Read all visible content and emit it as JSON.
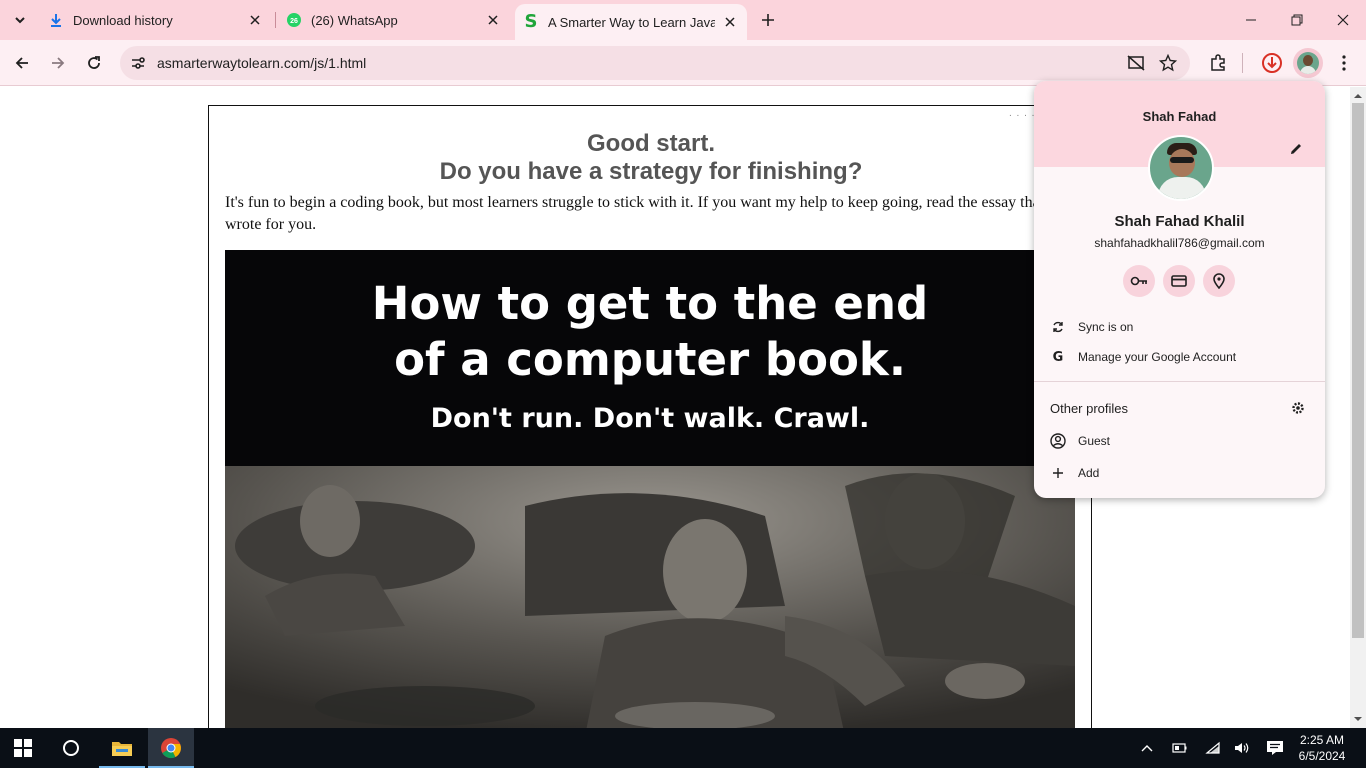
{
  "browser": {
    "tabs": [
      {
        "title": "Download history",
        "icon": "download-icon"
      },
      {
        "title": "(26) WhatsApp",
        "icon": "whatsapp-icon",
        "badge": "26"
      },
      {
        "title": "A Smarter Way to Learn JavaScript",
        "icon": "smarter-way-icon"
      }
    ],
    "url": "asmarterwaytolearn.com/js/1.html"
  },
  "page": {
    "heading1": "Good start.",
    "heading2": "Do you have a strategy for finishing?",
    "intro": "It's fun to begin a coding book, but most learners struggle to stick with it. If you want my help to keep going, read the essay that I wrote for you.",
    "banner": {
      "line1": "How to get to the end",
      "line2": "of a computer book.",
      "line3": "Don't run. Don't walk. Crawl."
    }
  },
  "profile_menu": {
    "header_name": "Shah Fahad",
    "full_name": "Shah Fahad Khalil",
    "email": "shahfahadkhalil786@gmail.com",
    "sync": "Sync is on",
    "manage": "Manage your Google Account",
    "other_profiles": "Other profiles",
    "guest": "Guest",
    "add": "Add"
  },
  "taskbar": {
    "time": "2:25 AM",
    "date": "6/5/2024"
  },
  "colors": {
    "tabstrip": "#fbd4dc",
    "toolbar": "#fdeff3",
    "menu_header": "#fcd7df",
    "download_red": "#d93025",
    "whatsapp_green": "#25d366",
    "smarter_green": "#20a53a"
  }
}
